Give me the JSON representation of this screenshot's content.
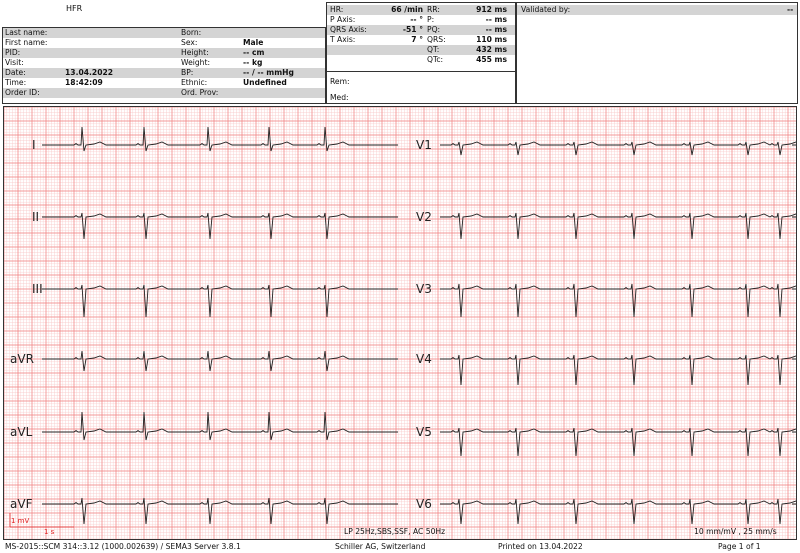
{
  "header": {
    "institution": "HFR",
    "patient": {
      "last_name_label": "Last name:",
      "first_name_label": "First name:",
      "pid_label": "PID:",
      "visit_label": "Visit:",
      "date_label": "Date:",
      "date": "13.04.2022",
      "time_label": "Time:",
      "time": "18:42:09",
      "order_id_label": "Order ID:",
      "born_label": "Born:",
      "sex_label": "Sex:",
      "sex": "Male",
      "height_label": "Height:",
      "height": "--  cm",
      "weight_label": "Weight:",
      "weight": "--  kg",
      "bp_label": "BP:",
      "bp": "-- / -- mmHg",
      "ethnic_label": "Ethnic:",
      "ethnic": "Undefined",
      "ord_prov_label": "Ord. Prov:"
    },
    "measurements": {
      "hr_label": "HR:",
      "hr": "66 /min",
      "rr_label": "RR:",
      "rr": "912 ms",
      "p_axis_label": "P Axis:",
      "p_axis": "-- °",
      "p_label": "P:",
      "p": "-- ms",
      "qrs_axis_label": "QRS Axis:",
      "qrs_axis": "-51 °",
      "pq_label": "PQ:",
      "pq": "-- ms",
      "t_axis_label": "T Axis:",
      "t_axis": "7 °",
      "qrs_label": "QRS:",
      "qrs": "110 ms",
      "qt_label": "QT:",
      "qt": "432 ms",
      "qtc_label": "QTc:",
      "qtc": "455 ms",
      "rem_label": "Rem:",
      "med_label": "Med:"
    },
    "validated_by_label": "Validated by:",
    "validated_by": "--"
  },
  "ecg": {
    "leads_left": [
      "I",
      "II",
      "III",
      "aVR",
      "aVL",
      "aVF"
    ],
    "leads_right": [
      "V1",
      "V2",
      "V3",
      "V4",
      "V5",
      "V6"
    ],
    "calibration_mv": "1 mV",
    "calibration_s": "1 s",
    "filter": "LP 25Hz,SBS,SSF, AC 50Hz",
    "gain_speed": "10 mm/mV , 25 mm/s",
    "grid_color": "#f08080",
    "trace_color": "#222222",
    "calibration_color": "#e02020"
  },
  "footer": {
    "software": "MS-2015::SCM 314::3.12 (1000.002639) / SEMA3 Server 3.8.1",
    "vendor": "Schiller AG, Switzerland",
    "printed": "Printed on 13.04.2022",
    "page": "Page 1 of 1"
  }
}
